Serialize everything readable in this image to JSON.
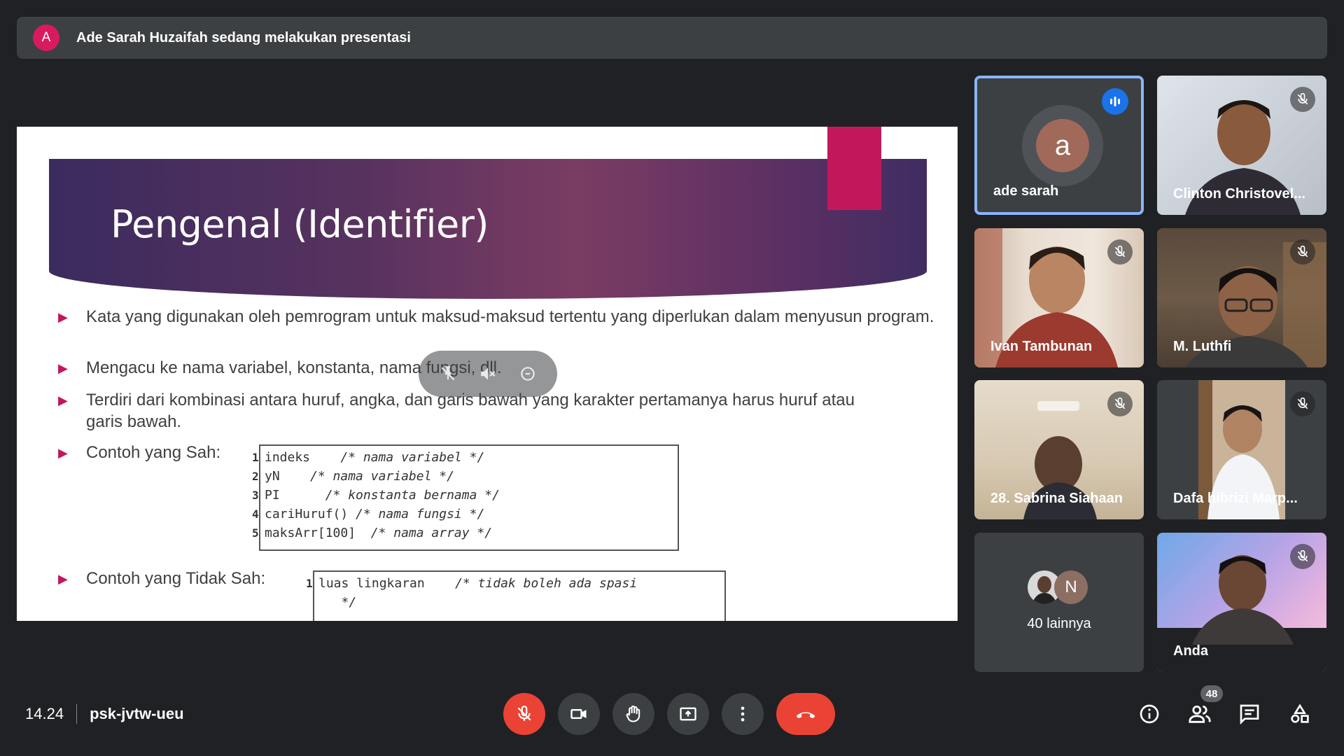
{
  "banner": {
    "avatar_letter": "A",
    "text": "Ade Sarah Huzaifah sedang melakukan presentasi"
  },
  "slide": {
    "title": "Pengenal (Identifier)",
    "bullets": [
      "Kata yang digunakan oleh pemrogram untuk maksud-maksud tertentu yang diperlukan dalam menyusun program.",
      "Mengacu ke nama variabel, konstanta, nama fungsi, dll.",
      "Terdiri dari kombinasi antara huruf, angka, dan garis bawah yang karakter pertamanya harus huruf atau garis bawah.",
      "Contoh yang Sah:",
      "Contoh yang Tidak Sah:"
    ],
    "valid_code": [
      {
        "n": "1",
        "code": "indeks    ",
        "comment": "/* nama variabel */"
      },
      {
        "n": "2",
        "code": "yN    ",
        "comment": "/* nama variabel */"
      },
      {
        "n": "3",
        "code": "PI      ",
        "comment": "/* konstanta bernama */"
      },
      {
        "n": "4",
        "code": "cariHuruf() ",
        "comment": "/* nama fungsi */"
      },
      {
        "n": "5",
        "code": "maksArr[100]  ",
        "comment": "/* nama array */"
      }
    ],
    "invalid_code": [
      {
        "n": "1",
        "code": "luas lingkaran    ",
        "comment": "/* tidak boleh ada spasi"
      },
      {
        "n": "",
        "code": "   ",
        "comment": "*/"
      }
    ]
  },
  "participants": [
    {
      "name": "ade sarah",
      "avatar_letter": "a",
      "speaking": true
    },
    {
      "name": "Clinton Christovel..."
    },
    {
      "name": "Ivan Tambunan"
    },
    {
      "name": "M. Luthfi"
    },
    {
      "name": "28. Sabrina Siahaan"
    },
    {
      "name": "Dafa hibrizi Marp..."
    },
    {
      "name": "40 lainnya",
      "avatar_letter": "N"
    },
    {
      "name": "Anda"
    }
  ],
  "meeting": {
    "time": "14.24",
    "code": "psk-jvtw-ueu"
  },
  "controls": {
    "mic": "mic-off-icon",
    "camera": "camera-icon",
    "raise_hand": "hand-icon",
    "present": "present-icon",
    "more": "more-icon",
    "end": "end-call-icon"
  },
  "right": {
    "people_count": "48"
  },
  "colors": {
    "accent": "#1a73e8",
    "danger": "#ea4335",
    "bg": "#202124",
    "tile": "#3c4043"
  }
}
